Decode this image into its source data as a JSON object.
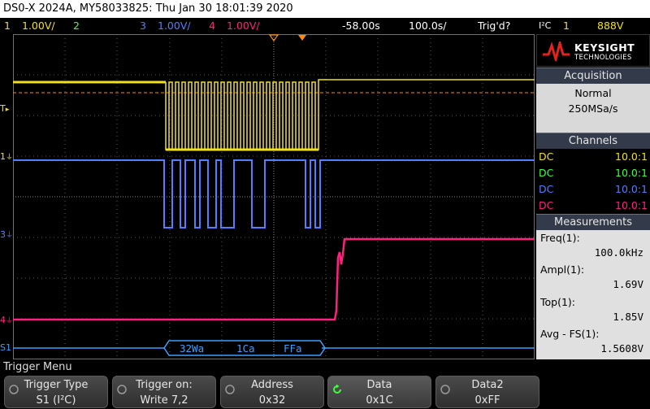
{
  "window_title": "DS0-X 2024A, MY58033825: Thu Jan 30 18:01:39 2020",
  "status": {
    "ch1_num": "1",
    "ch1_scale": "1.00V/",
    "ch2_num": "2",
    "ch3_num": "3",
    "ch3_scale": "1.00V/",
    "ch4_num": "4",
    "ch4_scale": "1.00V/",
    "time_offset": "-58.00s",
    "time_scale": "100.0s/",
    "trigger_state": "Trig'd?",
    "trigger_mode": "I²C",
    "trigger_source": "1",
    "trigger_level": "888V"
  },
  "brand": {
    "name": "KEYSIGHT",
    "sub": "TECHNOLOGIES"
  },
  "acquisition": {
    "header": "Acquisition",
    "mode": "Normal",
    "rate": "250MSa/s"
  },
  "channels": {
    "header": "Channels",
    "rows": [
      {
        "coupling": "DC",
        "probe": "10.0:1",
        "color": "#f0e020"
      },
      {
        "coupling": "DC",
        "probe": "10.0:1",
        "color": "#40ff40"
      },
      {
        "coupling": "DC",
        "probe": "10.0:1",
        "color": "#5080ff"
      },
      {
        "coupling": "DC",
        "probe": "10.0:1",
        "color": "#ff2080"
      }
    ]
  },
  "measurements": {
    "header": "Measurements",
    "items": [
      {
        "label": "Freq(1):",
        "value": "100.0kHz"
      },
      {
        "label": "Ampl(1):",
        "value": "1.69V"
      },
      {
        "label": "Top(1):",
        "value": "1.85V"
      },
      {
        "label": "Avg - FS(1):",
        "value": "1.5608V"
      }
    ]
  },
  "markers": {
    "trigger": "T",
    "ch1": "1",
    "ch3": "3",
    "ch4": "4",
    "serial": "S1"
  },
  "decode": {
    "addr": "32Wa",
    "data1": "1Ca",
    "data2": "FFa"
  },
  "menu_title": "Trigger Menu",
  "softkeys": [
    {
      "title": "Trigger Type",
      "value": "S1 (I²C)"
    },
    {
      "title": "Trigger on:",
      "value": "Write 7,2"
    },
    {
      "title": "Address",
      "value": "0x32"
    },
    {
      "title": "Data",
      "value": "0x1C"
    },
    {
      "title": "Data2",
      "value": "0xFF"
    }
  ],
  "colors": {
    "ch1": "#f0e020",
    "ch2": "#40ff40",
    "ch3": "#5080ff",
    "ch4": "#ff2080",
    "serial": "#3aa0ff",
    "trigger": "#ff8c00"
  }
}
